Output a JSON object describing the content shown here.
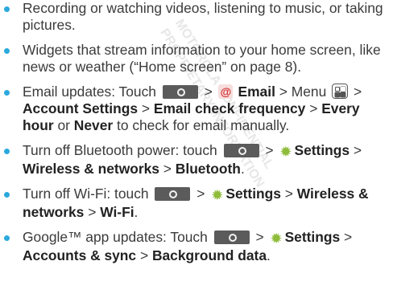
{
  "watermark": [
    "MOTOROLA CONFIDENTIAL",
    "PROPRIETARY INFORMATION"
  ],
  "icons": {
    "home_key": "home-key-icon",
    "email_app": "email-app-icon",
    "menu": "menu-key-icon",
    "settings": "gear-icon"
  },
  "colors": {
    "bullet": "#2aa9dd",
    "home_key": "#5b5b5b",
    "gear": "#8fbc3b",
    "email_at": "#d32f2f"
  },
  "bullets": [
    {
      "text": "Recording or watching videos, listening to music, or taking pictures."
    },
    {
      "text": "Widgets that stream information to your home screen, like news or weather (“Home screen” on page 8)."
    },
    {
      "t1": "Email updates: Touch",
      "gt": ">",
      "email": "Email",
      "menu_word": "Menu",
      "account_settings": "Account Settings",
      "email_check_frequency": "Email check frequency",
      "every_hour": "Every hour",
      "or": "or",
      "never": "Never",
      "tail": "to check for email manually."
    },
    {
      "t1": "Turn off Bluetooth power: touch",
      "gt": ">",
      "settings": "Settings",
      "wireless_networks": "Wireless & networks",
      "bluetooth": "Bluetooth",
      "period": "."
    },
    {
      "t1": "Turn off Wi-Fi: touch",
      "gt": ">",
      "settings": "Settings",
      "wireless": "Wireless",
      "and_networks": "& networks",
      "wifi": "Wi-Fi",
      "period": "."
    },
    {
      "t1": "Google™ app updates: Touch",
      "gt": ">",
      "settings": "Settings",
      "accounts_sync": "Accounts & sync",
      "background_data": "Background data",
      "period": "."
    }
  ]
}
